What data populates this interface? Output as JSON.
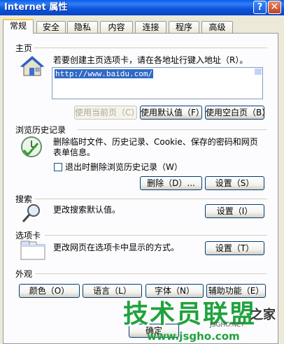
{
  "window": {
    "title": "Internet 属性",
    "help_glyph": "?",
    "close_glyph": "✕"
  },
  "tabs": [
    "常规",
    "安全",
    "隐私",
    "内容",
    "连接",
    "程序",
    "高级"
  ],
  "homepage": {
    "section_title": "主页",
    "description": "若要创建主页选项卡，请在各地址行键入地址（R）。",
    "address": "http://www.baidu.com/",
    "buttons": {
      "use_current": "使用当前页（C）",
      "use_default": "使用默认值（F）",
      "use_blank": "使用空白页（B）"
    }
  },
  "history": {
    "section_title": "浏览历史记录",
    "description": "删除临时文件、历史记录、Cookie、保存的密码和网页表单信息。",
    "checkbox_label": "退出时删除浏览历史记录（W）",
    "buttons": {
      "delete": "删除（D）...",
      "settings": "设置（S）"
    }
  },
  "search": {
    "section_title": "搜索",
    "description": "更改搜索默认值。",
    "settings_button": "设置（I）"
  },
  "tabs_section": {
    "section_title": "选项卡",
    "description": "更改网页在选项卡中显示的方式。",
    "settings_button": "设置（T）"
  },
  "appearance": {
    "section_title": "外观",
    "buttons": {
      "colors": "颜色（O）",
      "languages": "语言（L）",
      "fonts": "字体（N）",
      "accessibility": "辅助功能（E）"
    }
  },
  "footer": {
    "ok_label": "确定"
  },
  "watermark": {
    "brand": "技术员联盟",
    "suffix": "之家",
    "url": "www.jsgho.com",
    "en": "JSGHO.NET"
  }
}
